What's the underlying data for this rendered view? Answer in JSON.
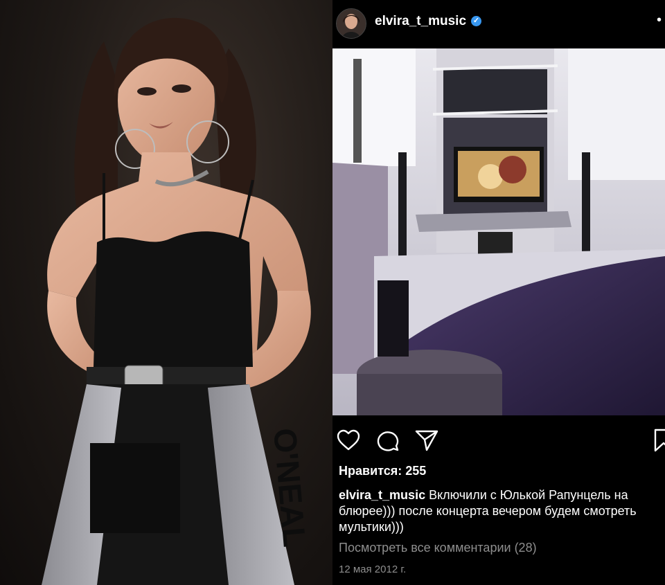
{
  "post": {
    "username": "elvira_t_music",
    "verified_icon": "verified-badge-icon",
    "more_label": "•",
    "likes_text": "Нравится: 255",
    "caption_username": "elvira_t_music",
    "caption_text": " Включили с Юлькой Рапунцель на блюрее))) после концерта вечером будем смотреть мультики)))",
    "view_comments": "Посмотреть все комментарии (28)",
    "date": "12 мая 2012 г."
  },
  "icons": {
    "like": "heart-icon",
    "comment": "comment-icon",
    "share": "share-icon",
    "save": "bookmark-icon"
  },
  "colors": {
    "background": "#000000",
    "text": "#ffffff",
    "secondary_text": "#8e8e8e",
    "verified": "#3897f0"
  },
  "pants_brand_text": "O'NEAL"
}
